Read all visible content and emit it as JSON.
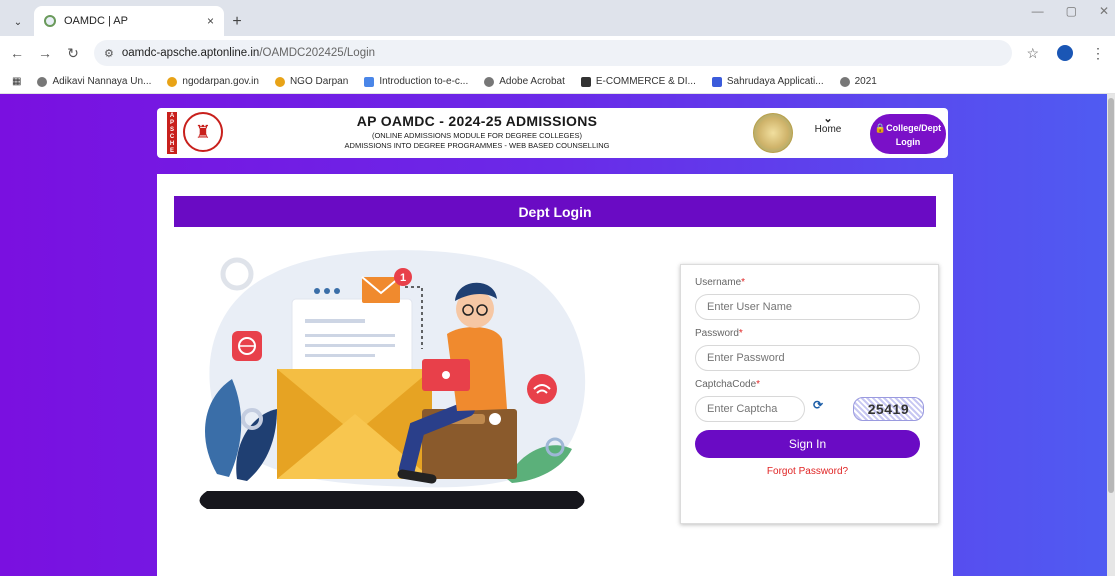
{
  "browser": {
    "tab_title": "OAMDC | AP",
    "tab_close": "×",
    "new_tab": "+",
    "url_host": "oamdc-apsche.aptonline.in",
    "url_path": "/OAMDC202425/Login",
    "bookmarks": [
      {
        "label": "Adikavi Nannaya Un...",
        "color": "#777777"
      },
      {
        "label": "ngodarpan.gov.in",
        "color": "#e8a317"
      },
      {
        "label": "NGO Darpan",
        "color": "#e8a317"
      },
      {
        "label": "Introduction to-e-c...",
        "color": "#4a86e8"
      },
      {
        "label": "Adobe Acrobat",
        "color": "#777777"
      },
      {
        "label": "E-COMMERCE & DI...",
        "color": "#333333"
      },
      {
        "label": "Sahrudaya Applicati...",
        "color": "#3b5bdb"
      },
      {
        "label": "2021",
        "color": "#777777"
      }
    ]
  },
  "header": {
    "logo_letters": [
      "A",
      "P",
      "S",
      "C",
      "H",
      "E"
    ],
    "title": "AP OAMDC - 2024-25 ADMISSIONS",
    "subtitle1": "(ONLINE ADMISSIONS MODULE FOR DEGREE COLLEGES)",
    "subtitle2": "ADMISSIONS INTO DEGREE PROGRAMMES - WEB BASED COUNSELLING",
    "home_label": "Home",
    "college_btn_line1": "College/Dept",
    "college_btn_line2": "Login"
  },
  "card": {
    "title": "Dept Login"
  },
  "login": {
    "username_label": "Username",
    "username_placeholder": "Enter User Name",
    "password_label": "Password",
    "password_placeholder": "Enter Password",
    "captcha_label": "CaptchaCode",
    "captcha_placeholder": "Enter Captcha",
    "captcha_value": "25419",
    "required_mark": "*",
    "signin_label": "Sign In",
    "forgot_label": "Forgot Password?"
  },
  "illustration": {
    "notification_count": "1"
  },
  "colors": {
    "primary_purple": "#6a0bc4",
    "bg_gradient_start": "#7a10e0",
    "bg_gradient_end": "#4f5cf2",
    "forgot_red": "#e02424"
  }
}
